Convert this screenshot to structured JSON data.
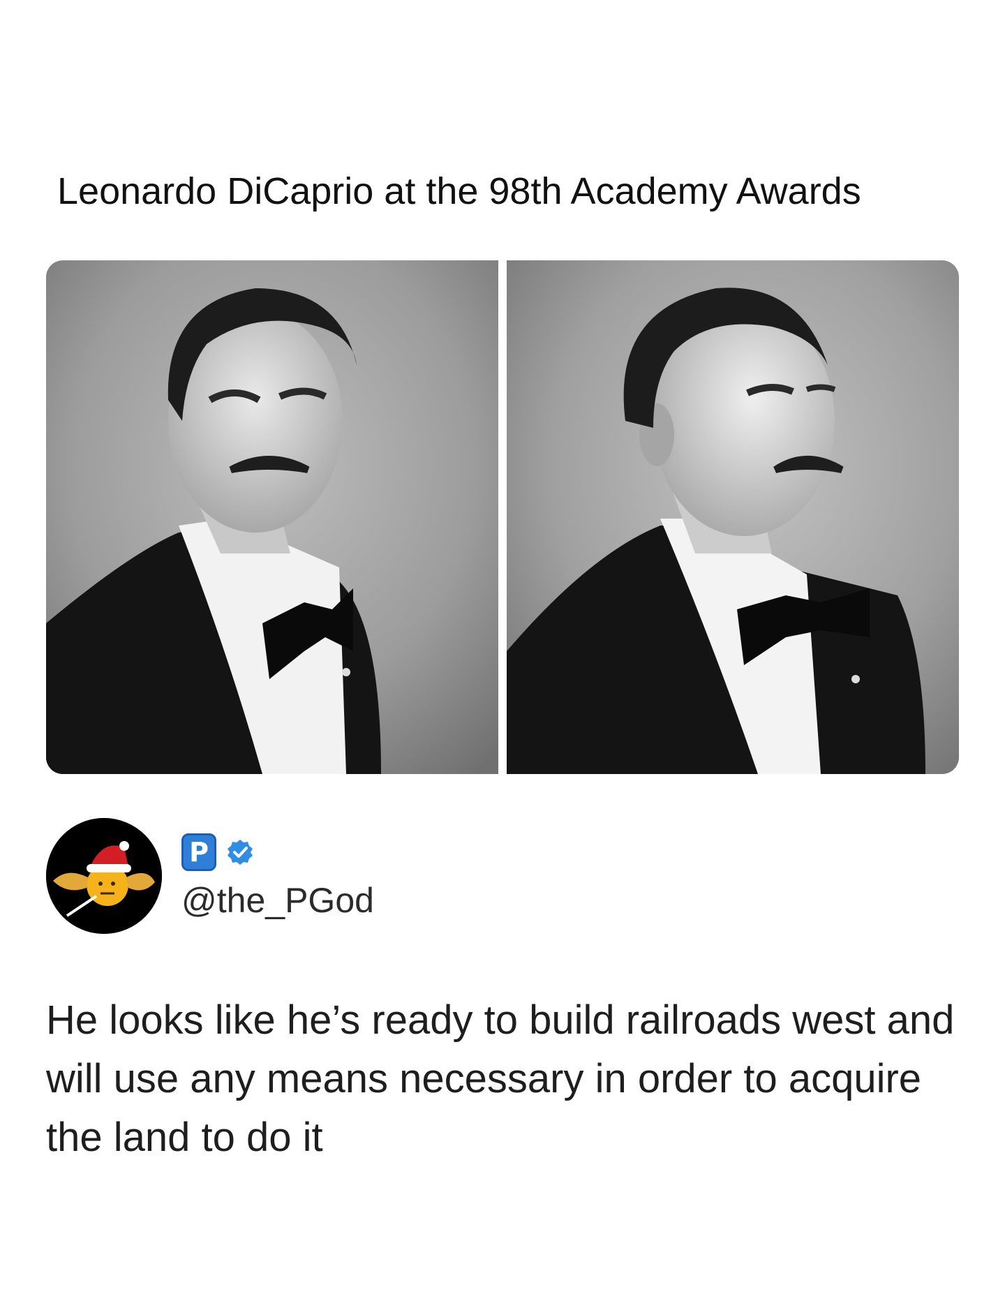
{
  "post": {
    "headline": "Leonardo DiCaprio at the 98th Academy Awards",
    "images": [
      {
        "alt": "photo-left"
      },
      {
        "alt": "photo-right"
      }
    ],
    "author": {
      "badge_letter": "P",
      "verified_icon": "verified-check-icon",
      "handle": "@the_PGod",
      "accent_color": "#2f7fd8"
    },
    "body": "He looks like he’s ready to build railroads west and will use any means necessary in order to acquire the land to do it"
  }
}
